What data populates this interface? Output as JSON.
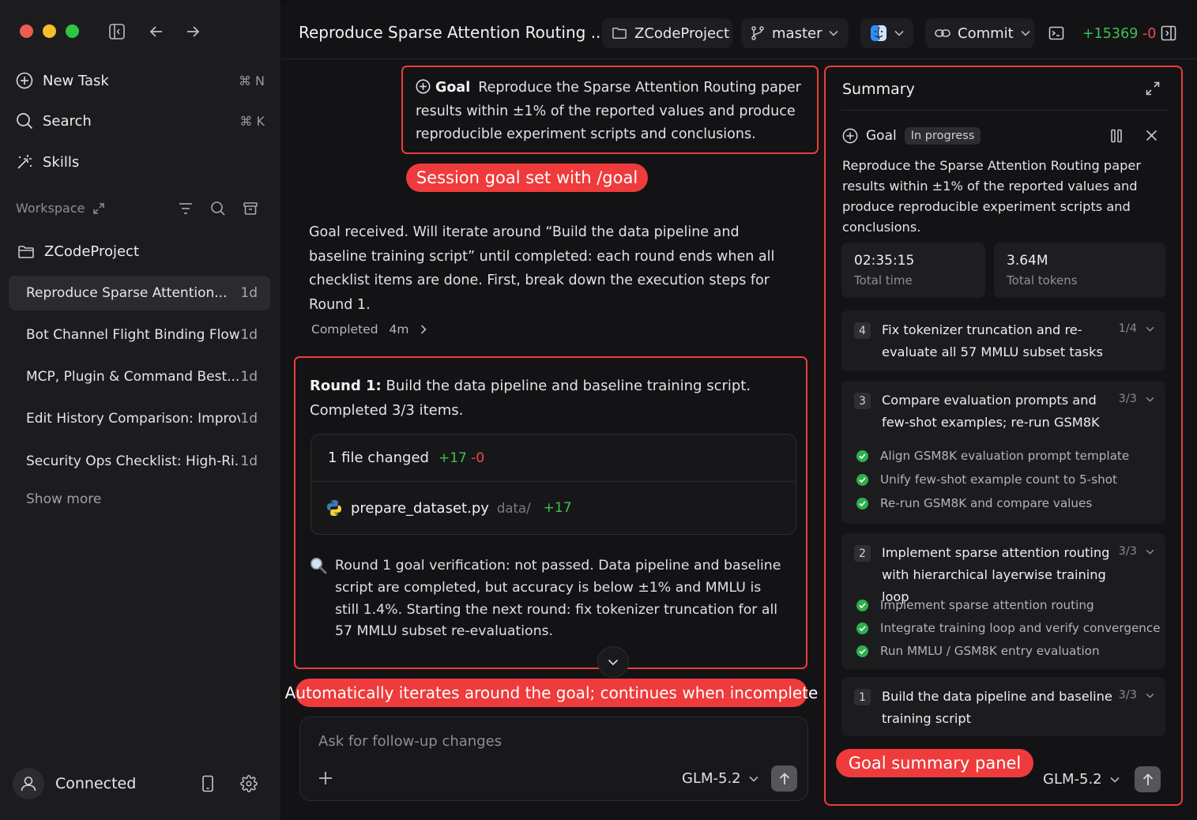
{
  "colors": {
    "accent_red": "#ef3b3b",
    "diff_green": "#3fbf55",
    "diff_red": "#ef4a4a",
    "check_green": "#2fb04a"
  },
  "sidebar": {
    "nav": [
      {
        "label": "New Task",
        "shortcut": "⌘ N",
        "icon": "plus-circle-icon"
      },
      {
        "label": "Search",
        "shortcut": "⌘ K",
        "icon": "search-icon"
      },
      {
        "label": "Skills",
        "shortcut": "",
        "icon": "magic-wand-icon"
      }
    ],
    "workspace_label": "Workspace",
    "project": "ZCodeProject",
    "tasks": [
      {
        "title": "Reproduce Sparse Attention...",
        "age": "1d"
      },
      {
        "title": "Bot Channel Flight Binding Flow...",
        "age": "1d"
      },
      {
        "title": "MCP, Plugin & Command Best...",
        "age": "1d"
      },
      {
        "title": "Edit History Comparison: Improv...",
        "age": "1d"
      },
      {
        "title": "Security Ops Checklist: High-Ri...",
        "age": "1d"
      }
    ],
    "show_more": "Show more",
    "status": "Connected"
  },
  "topbar": {
    "title": "Reproduce Sparse Attention Routing ...",
    "project": "ZCodeProject",
    "branch": "master",
    "commit": "Commit",
    "diff_add": "+15369",
    "diff_del": "-0"
  },
  "chat": {
    "goal_label": "Goal",
    "goal_text": "Reproduce the Sparse Attention Routing paper results within ±1% of the reported values and produce reproducible experiment scripts and conclusions.",
    "annot_goal": "Session goal set with /goal",
    "message": "Goal received. Will iterate around “Build the data pipeline and baseline training script” until completed: each round ends when all checklist items are done. First, break down the execution steps for Round 1.",
    "completed_label": "Completed",
    "completed_time": "4m",
    "round_prefix": "Round 1:",
    "round_text": "Build the data pipeline and baseline training script.",
    "round_status": "Completed 3/3 items.",
    "files_changed": "1 file changed",
    "files_add": "+17",
    "files_del": "-0",
    "file_name": "prepare_dataset.py",
    "file_dir": "data/",
    "file_add": "+17",
    "verification": "Round 1 goal verification: not passed. Data pipeline and baseline script are completed, but accuracy is below ±1% and MMLU is still 1.4%. Starting the next round: fix tokenizer truncation for all 57 MMLU subset re-evaluations.",
    "annot_iterate": "Automatically iterates around the goal; continues when incomplete",
    "input_placeholder": "Ask for follow-up changes",
    "model": "GLM-5.2"
  },
  "summary": {
    "title": "Summary",
    "goal_label": "Goal",
    "status": "In progress",
    "goal_text": "Reproduce the Sparse Attention Routing paper results within ±1% of the reported values and produce reproducible experiment scripts and conclusions.",
    "total_time": "02:35:15",
    "total_time_label": "Total time",
    "total_tokens": "3.64M",
    "total_tokens_label": "Total tokens",
    "rounds": [
      {
        "num": "4",
        "title": "Fix tokenizer truncation and re-evaluate all 57 MMLU subset tasks",
        "count": "1/4",
        "items": []
      },
      {
        "num": "3",
        "title": "Compare evaluation prompts and few-shot examples; re-run GSM8K",
        "count": "3/3",
        "items": [
          "Align GSM8K evaluation prompt template",
          "Unify few-shot example count to 5-shot",
          "Re-run GSM8K and compare values"
        ]
      },
      {
        "num": "2",
        "title": "Implement sparse attention routing with hierarchical layerwise training loop",
        "count": "3/3",
        "items": [
          "Implement sparse attention routing",
          "Integrate training loop and verify convergence",
          "Run MMLU / GSM8K entry evaluation"
        ]
      },
      {
        "num": "1",
        "title": "Build the data pipeline and baseline training script",
        "count": "3/3",
        "items": []
      }
    ],
    "annot_panel": "Goal summary panel",
    "model": "GLM-5.2"
  }
}
